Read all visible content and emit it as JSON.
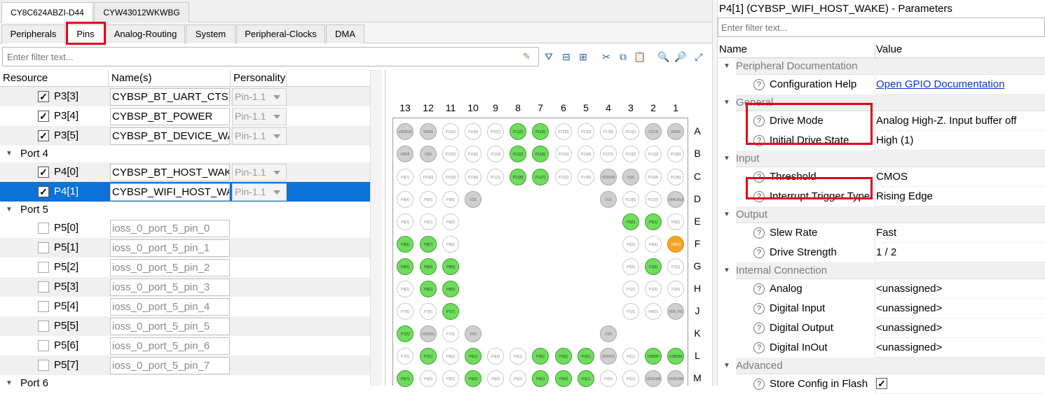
{
  "device_tabs": [
    "CY8C624ABZI-D44",
    "CYW43012WKWBG"
  ],
  "sub_tabs": [
    "Peripherals",
    "Pins",
    "Analog-Routing",
    "System",
    "Peripheral-Clocks",
    "DMA"
  ],
  "filter": {
    "placeholder": "Enter filter text..."
  },
  "table": {
    "headers": [
      "Resource",
      "Name(s)",
      "Personality"
    ],
    "rows": [
      {
        "type": "pin",
        "res": "P3[3]",
        "name": "CYBSP_BT_UART_CTS",
        "pers": "Pin-1.1",
        "checked": true
      },
      {
        "type": "pin",
        "res": "P3[4]",
        "name": "CYBSP_BT_POWER",
        "pers": "Pin-1.1",
        "checked": true
      },
      {
        "type": "pin",
        "res": "P3[5]",
        "name": "CYBSP_BT_DEVICE_WAKE",
        "pers": "Pin-1.1",
        "checked": true
      },
      {
        "type": "group",
        "label": "Port 4"
      },
      {
        "type": "pin",
        "res": "P4[0]",
        "name": "CYBSP_BT_HOST_WAKE",
        "pers": "Pin-1.1",
        "checked": true
      },
      {
        "type": "pin",
        "res": "P4[1]",
        "name": "CYBSP_WIFI_HOST_WAKE",
        "pers": "Pin-1.1",
        "checked": true,
        "selected": true
      },
      {
        "type": "group",
        "label": "Port 5"
      },
      {
        "type": "pin",
        "res": "P5[0]",
        "name": "ioss_0_port_5_pin_0",
        "pers": "",
        "checked": false
      },
      {
        "type": "pin",
        "res": "P5[1]",
        "name": "ioss_0_port_5_pin_1",
        "pers": "",
        "checked": false
      },
      {
        "type": "pin",
        "res": "P5[2]",
        "name": "ioss_0_port_5_pin_2",
        "pers": "",
        "checked": false
      },
      {
        "type": "pin",
        "res": "P5[3]",
        "name": "ioss_0_port_5_pin_3",
        "pers": "",
        "checked": false
      },
      {
        "type": "pin",
        "res": "P5[4]",
        "name": "ioss_0_port_5_pin_4",
        "pers": "",
        "checked": false
      },
      {
        "type": "pin",
        "res": "P5[5]",
        "name": "ioss_0_port_5_pin_5",
        "pers": "",
        "checked": false
      },
      {
        "type": "pin",
        "res": "P5[6]",
        "name": "ioss_0_port_5_pin_6",
        "pers": "",
        "checked": false
      },
      {
        "type": "pin",
        "res": "P5[7]",
        "name": "ioss_0_port_5_pin_7",
        "pers": "",
        "checked": false
      },
      {
        "type": "group",
        "label": "Port 6"
      }
    ]
  },
  "diagram": {
    "columns": [
      "13",
      "12",
      "11",
      "10",
      "9",
      "8",
      "7",
      "6",
      "5",
      "4",
      "3",
      "2",
      "1"
    ],
    "rows": [
      "A",
      "B",
      "C",
      "D",
      "E",
      "F",
      "G",
      "H",
      "J",
      "K",
      "L",
      "M"
    ],
    "pins": [
      {
        "r": 0,
        "c": 0,
        "t": "VDDIOA",
        "k": "pwr"
      },
      {
        "r": 0,
        "c": 1,
        "t": "VDDA",
        "k": "pwr"
      },
      {
        "r": 0,
        "c": 2,
        "t": "P10[1]",
        "k": ""
      },
      {
        "r": 0,
        "c": 3,
        "t": "P10[4]",
        "k": ""
      },
      {
        "r": 0,
        "c": 4,
        "t": "P10[7]",
        "k": ""
      },
      {
        "r": 0,
        "c": 5,
        "t": "P11[2]",
        "k": "used"
      },
      {
        "r": 0,
        "c": 6,
        "t": "P11[5]",
        "k": "used"
      },
      {
        "r": 0,
        "c": 7,
        "t": "P12[0]",
        "k": ""
      },
      {
        "r": 0,
        "c": 8,
        "t": "P12[3]",
        "k": ""
      },
      {
        "r": 0,
        "c": 9,
        "t": "P12[6]",
        "k": ""
      },
      {
        "r": 0,
        "c": 10,
        "t": "P13[1]",
        "k": ""
      },
      {
        "r": 0,
        "c": 11,
        "t": "VCCD",
        "k": "pwr"
      },
      {
        "r": 0,
        "c": 12,
        "t": "VDDD",
        "k": "pwr"
      },
      {
        "r": 1,
        "c": 0,
        "t": "VREF",
        "k": "pwr"
      },
      {
        "r": 1,
        "c": 1,
        "t": "VSS",
        "k": "pwr"
      },
      {
        "r": 1,
        "c": 2,
        "t": "P10[2]",
        "k": ""
      },
      {
        "r": 1,
        "c": 3,
        "t": "P10[5]",
        "k": ""
      },
      {
        "r": 1,
        "c": 4,
        "t": "P11[0]",
        "k": ""
      },
      {
        "r": 1,
        "c": 5,
        "t": "P11[3]",
        "k": "used"
      },
      {
        "r": 1,
        "c": 6,
        "t": "P11[6]",
        "k": "used"
      },
      {
        "r": 1,
        "c": 7,
        "t": "P12[1]",
        "k": ""
      },
      {
        "r": 1,
        "c": 8,
        "t": "P12[4]",
        "k": ""
      },
      {
        "r": 1,
        "c": 9,
        "t": "P12[7]",
        "k": ""
      },
      {
        "r": 1,
        "c": 10,
        "t": "P13[2]",
        "k": ""
      },
      {
        "r": 1,
        "c": 11,
        "t": "P13[3]",
        "k": ""
      },
      {
        "r": 1,
        "c": 12,
        "t": "P13[0]",
        "k": ""
      },
      {
        "r": 2,
        "c": 0,
        "t": "P9[7]",
        "k": ""
      },
      {
        "r": 2,
        "c": 1,
        "t": "P10[0]",
        "k": ""
      },
      {
        "r": 2,
        "c": 2,
        "t": "P10[3]",
        "k": ""
      },
      {
        "r": 2,
        "c": 3,
        "t": "P10[6]",
        "k": ""
      },
      {
        "r": 2,
        "c": 4,
        "t": "P11[1]",
        "k": ""
      },
      {
        "r": 2,
        "c": 5,
        "t": "P11[4]",
        "k": "used"
      },
      {
        "r": 2,
        "c": 6,
        "t": "P11[7]",
        "k": "used"
      },
      {
        "r": 2,
        "c": 7,
        "t": "P12[2]",
        "k": ""
      },
      {
        "r": 2,
        "c": 8,
        "t": "P12[5]",
        "k": ""
      },
      {
        "r": 2,
        "c": 9,
        "t": "VDDIO0",
        "k": "pwr"
      },
      {
        "r": 2,
        "c": 10,
        "t": "VSS",
        "k": "pwr"
      },
      {
        "r": 2,
        "c": 11,
        "t": "P13[4]",
        "k": ""
      },
      {
        "r": 2,
        "c": 12,
        "t": "P13[5]",
        "k": ""
      },
      {
        "r": 3,
        "c": 0,
        "t": "P9[4]",
        "k": ""
      },
      {
        "r": 3,
        "c": 1,
        "t": "P9[5]",
        "k": ""
      },
      {
        "r": 3,
        "c": 2,
        "t": "P9[6]",
        "k": ""
      },
      {
        "r": 3,
        "c": 3,
        "t": "VSS",
        "k": "pwr"
      },
      {
        "r": 3,
        "c": 9,
        "t": "VSS",
        "k": "pwr"
      },
      {
        "r": 3,
        "c": 10,
        "t": "P13[6]",
        "k": ""
      },
      {
        "r": 3,
        "c": 11,
        "t": "P13[7]",
        "k": ""
      },
      {
        "r": 3,
        "c": 12,
        "t": "VBACKUP",
        "k": "pwr"
      },
      {
        "r": 4,
        "c": 0,
        "t": "P9[2]",
        "k": ""
      },
      {
        "r": 4,
        "c": 1,
        "t": "P9[1]",
        "k": ""
      },
      {
        "r": 4,
        "c": 2,
        "t": "P9[0]",
        "k": ""
      },
      {
        "r": 4,
        "c": 10,
        "t": "P0[0]",
        "k": "used"
      },
      {
        "r": 4,
        "c": 11,
        "t": "P0[1]",
        "k": "used"
      },
      {
        "r": 4,
        "c": 12,
        "t": "P0[2]",
        "k": ""
      },
      {
        "r": 5,
        "c": 0,
        "t": "P8[6]",
        "k": "used"
      },
      {
        "r": 5,
        "c": 1,
        "t": "P8[7]",
        "k": "used"
      },
      {
        "r": 5,
        "c": 2,
        "t": "P9[3]",
        "k": ""
      },
      {
        "r": 5,
        "c": 10,
        "t": "P0[3]",
        "k": ""
      },
      {
        "r": 5,
        "c": 11,
        "t": "P0[4]",
        "k": ""
      },
      {
        "r": 5,
        "c": 12,
        "t": "XRES",
        "k": "warn"
      },
      {
        "r": 6,
        "c": 0,
        "t": "P8[3]",
        "k": "used"
      },
      {
        "r": 6,
        "c": 1,
        "t": "P8[4]",
        "k": "used"
      },
      {
        "r": 6,
        "c": 2,
        "t": "P8[5]",
        "k": "used"
      },
      {
        "r": 6,
        "c": 10,
        "t": "P0[5]",
        "k": ""
      },
      {
        "r": 6,
        "c": 11,
        "t": "P1[0]",
        "k": "used"
      },
      {
        "r": 6,
        "c": 12,
        "t": "P1[1]",
        "k": ""
      },
      {
        "r": 7,
        "c": 0,
        "t": "P8[0]",
        "k": ""
      },
      {
        "r": 7,
        "c": 1,
        "t": "P8[1]",
        "k": "used"
      },
      {
        "r": 7,
        "c": 2,
        "t": "P8[2]",
        "k": "used"
      },
      {
        "r": 7,
        "c": 10,
        "t": "P1[2]",
        "k": ""
      },
      {
        "r": 7,
        "c": 11,
        "t": "P1[3]",
        "k": ""
      },
      {
        "r": 7,
        "c": 12,
        "t": "P1[4]",
        "k": ""
      },
      {
        "r": 8,
        "c": 0,
        "t": "P7[5]",
        "k": ""
      },
      {
        "r": 8,
        "c": 1,
        "t": "P7[6]",
        "k": ""
      },
      {
        "r": 8,
        "c": 2,
        "t": "P7[7]",
        "k": "used"
      },
      {
        "r": 8,
        "c": 10,
        "t": "P1[5]",
        "k": ""
      },
      {
        "r": 8,
        "c": 11,
        "t": "VIND1",
        "k": ""
      },
      {
        "r": 8,
        "c": 12,
        "t": "VDD_NS",
        "k": "pwr"
      },
      {
        "r": 9,
        "c": 0,
        "t": "P7[2]",
        "k": "used"
      },
      {
        "r": 9,
        "c": 1,
        "t": "VDDIO1",
        "k": "pwr"
      },
      {
        "r": 9,
        "c": 2,
        "t": "P7[4]",
        "k": ""
      },
      {
        "r": 9,
        "c": 3,
        "t": "VSS",
        "k": "pwr"
      },
      {
        "r": 9,
        "c": 9,
        "t": "VSS",
        "k": "pwr"
      },
      {
        "r": 10,
        "c": 0,
        "t": "P7[0]",
        "k": ""
      },
      {
        "r": 10,
        "c": 1,
        "t": "P7[1]",
        "k": "used"
      },
      {
        "r": 10,
        "c": 2,
        "t": "P6[2]",
        "k": ""
      },
      {
        "r": 10,
        "c": 3,
        "t": "P6[1]",
        "k": "used"
      },
      {
        "r": 10,
        "c": 4,
        "t": "P5[4]",
        "k": ""
      },
      {
        "r": 10,
        "c": 5,
        "t": "P5[1]",
        "k": ""
      },
      {
        "r": 10,
        "c": 6,
        "t": "P4[0]",
        "k": "used"
      },
      {
        "r": 10,
        "c": 7,
        "t": "P3[3]",
        "k": "used"
      },
      {
        "r": 10,
        "c": 8,
        "t": "P3[0]",
        "k": "used"
      },
      {
        "r": 10,
        "c": 9,
        "t": "VDDIO2",
        "k": "pwr"
      },
      {
        "r": 10,
        "c": 10,
        "t": "P2[1]",
        "k": ""
      },
      {
        "r": 10,
        "c": 11,
        "t": "USBDP",
        "k": "used"
      },
      {
        "r": 10,
        "c": 12,
        "t": "USBDM",
        "k": "used"
      },
      {
        "r": 11,
        "c": 0,
        "t": "P6[7]",
        "k": "used"
      },
      {
        "r": 11,
        "c": 1,
        "t": "P6[5]",
        "k": ""
      },
      {
        "r": 11,
        "c": 2,
        "t": "P6[3]",
        "k": ""
      },
      {
        "r": 11,
        "c": 3,
        "t": "P6[0]",
        "k": "used"
      },
      {
        "r": 11,
        "c": 4,
        "t": "P5[5]",
        "k": ""
      },
      {
        "r": 11,
        "c": 5,
        "t": "P5[2]",
        "k": ""
      },
      {
        "r": 11,
        "c": 6,
        "t": "P4[1]",
        "k": "used"
      },
      {
        "r": 11,
        "c": 7,
        "t": "P3[4]",
        "k": "used"
      },
      {
        "r": 11,
        "c": 8,
        "t": "P3[1]",
        "k": "used"
      },
      {
        "r": 11,
        "c": 9,
        "t": "P2[0]",
        "k": ""
      },
      {
        "r": 11,
        "c": 10,
        "t": "P2[2]",
        "k": ""
      },
      {
        "r": 11,
        "c": 11,
        "t": "VDDUSB",
        "k": "pwr"
      },
      {
        "r": 11,
        "c": 12,
        "t": "VDDUSB",
        "k": "pwr"
      }
    ]
  },
  "params": {
    "title": "P4[1] (CYBSP_WIFI_HOST_WAKE) - Parameters",
    "filter_placeholder": "Enter filter text...",
    "headers": [
      "Name",
      "Value"
    ],
    "rows": [
      {
        "type": "group",
        "label": "Peripheral Documentation"
      },
      {
        "type": "param",
        "name": "Configuration Help",
        "value": "Open GPIO Documentation",
        "link": true
      },
      {
        "type": "group",
        "label": "General"
      },
      {
        "type": "param",
        "name": "Drive Mode",
        "value": "Analog High-Z. Input buffer off"
      },
      {
        "type": "param",
        "name": "Initial Drive State",
        "value": "High (1)"
      },
      {
        "type": "group",
        "label": "Input"
      },
      {
        "type": "param",
        "name": "Threshold",
        "value": "CMOS"
      },
      {
        "type": "param",
        "name": "Interrupt Trigger Type",
        "value": "Rising Edge"
      },
      {
        "type": "group",
        "label": "Output"
      },
      {
        "type": "param",
        "name": "Slew Rate",
        "value": "Fast"
      },
      {
        "type": "param",
        "name": "Drive Strength",
        "value": "1 / 2"
      },
      {
        "type": "group",
        "label": "Internal Connection"
      },
      {
        "type": "param",
        "name": "Analog",
        "value": "<unassigned>"
      },
      {
        "type": "param",
        "name": "Digital Input",
        "value": "<unassigned>"
      },
      {
        "type": "param",
        "name": "Digital Output",
        "value": "<unassigned>"
      },
      {
        "type": "param",
        "name": "Digital InOut",
        "value": "<unassigned>"
      },
      {
        "type": "group",
        "label": "Advanced"
      },
      {
        "type": "param",
        "name": "Store Config in Flash",
        "value": "",
        "checkbox": true
      }
    ]
  },
  "colors": {
    "selection": "#0b72d8",
    "highlight": "#e0001b",
    "pin_used": "#6fdc5e",
    "pin_warn": "#f4a425"
  }
}
